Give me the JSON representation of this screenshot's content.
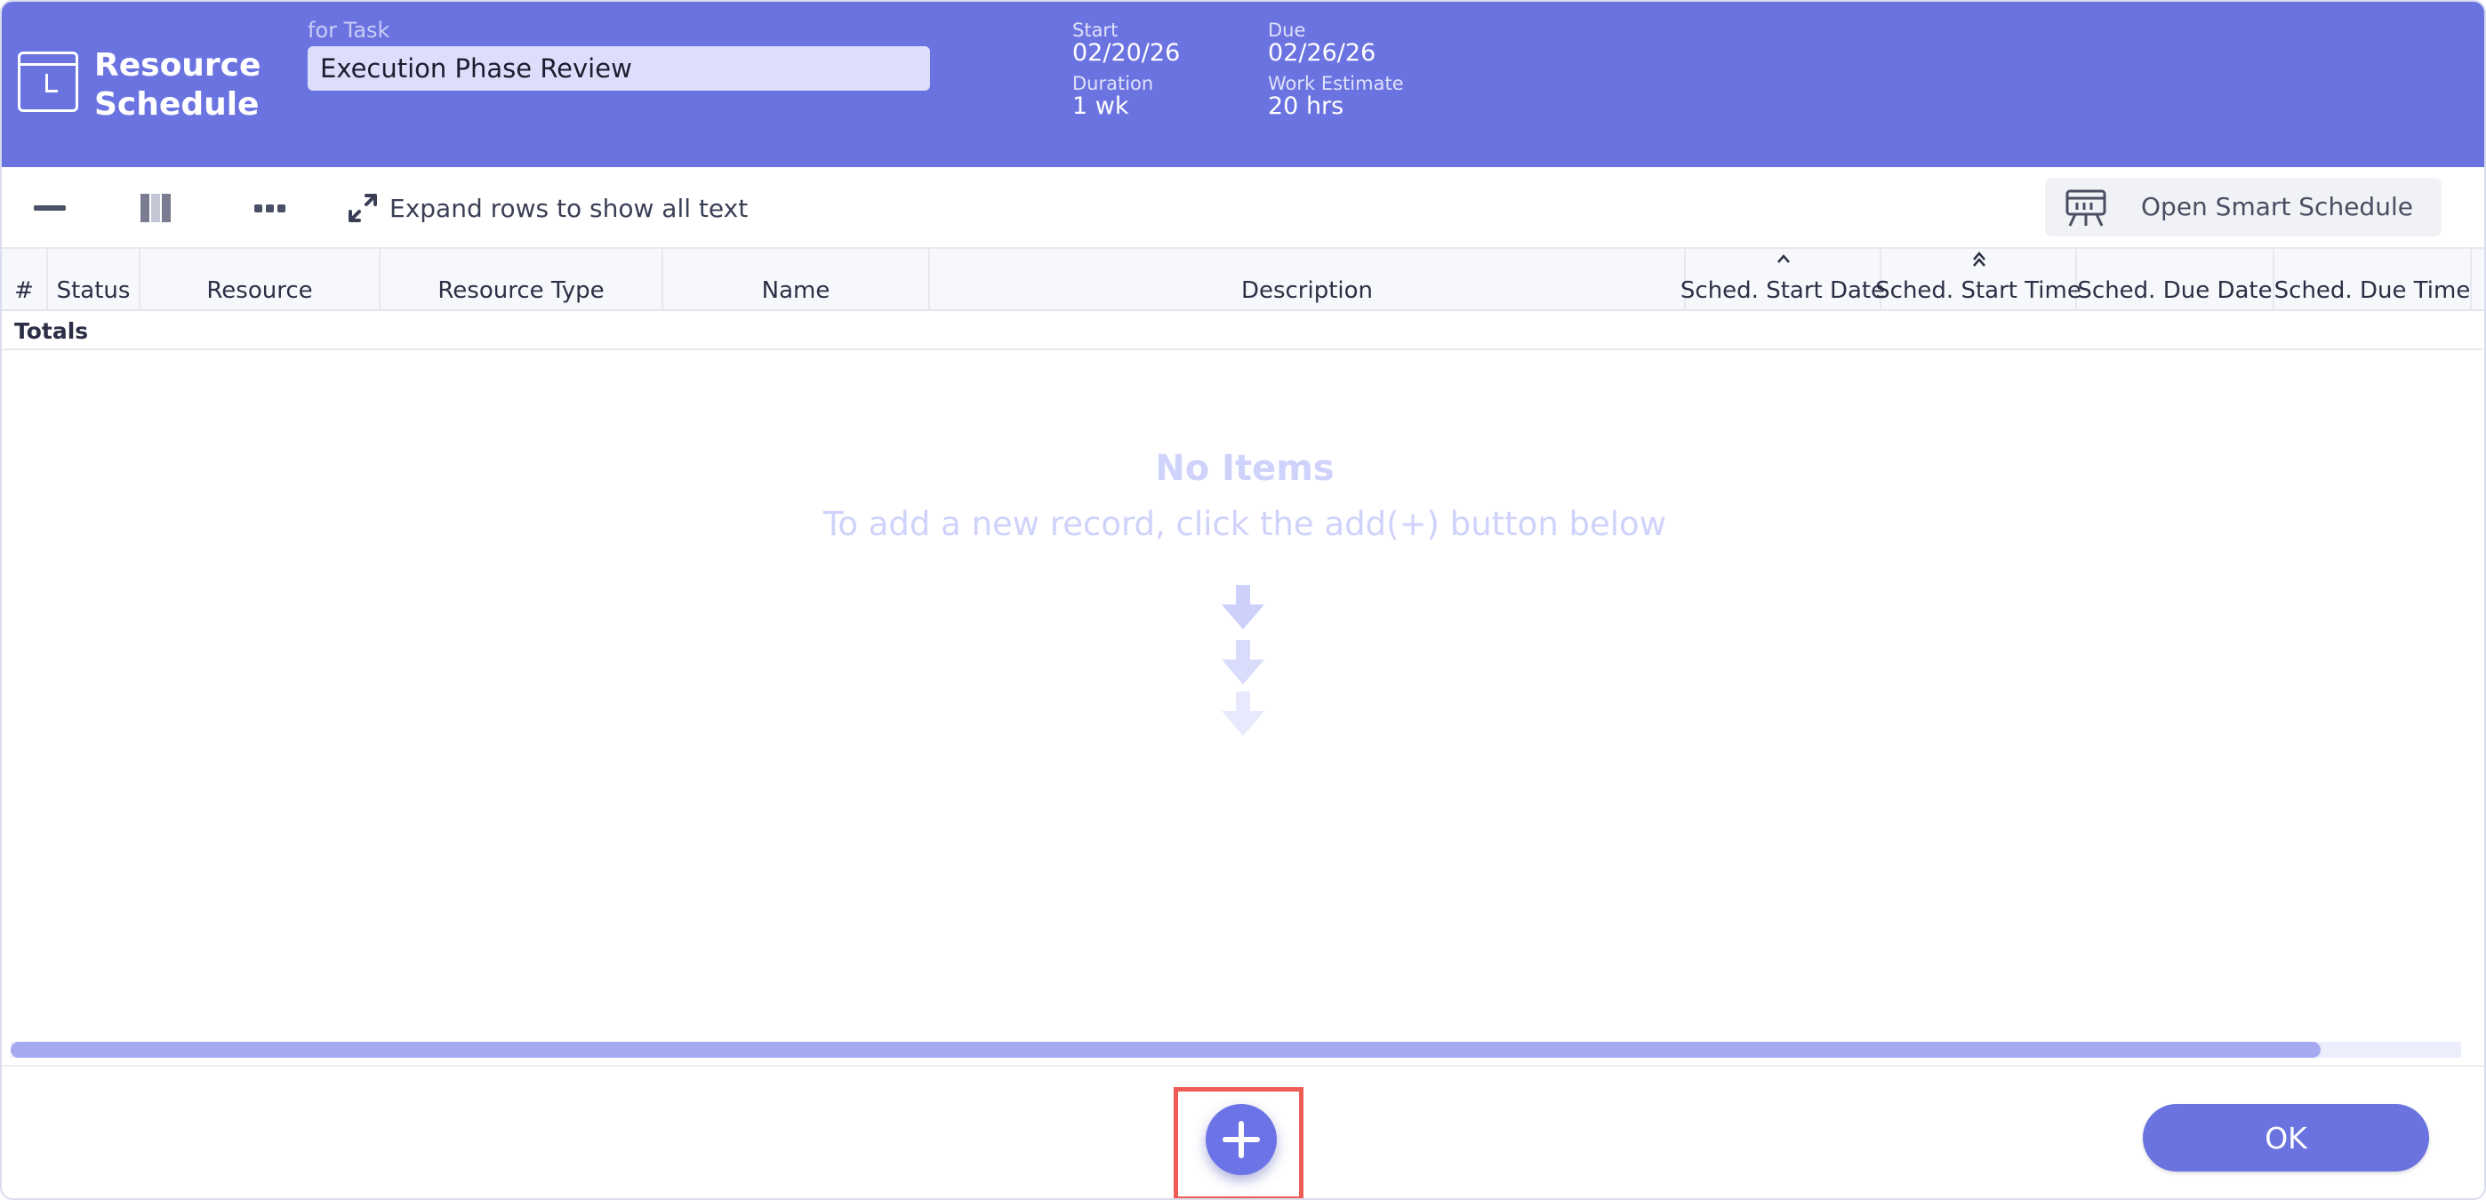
{
  "header": {
    "title": "Resource Schedule",
    "for_task_label": "for Task",
    "task_name": "Execution Phase Review",
    "start_label": "Start",
    "start_value": "02/20/26",
    "due_label": "Due",
    "due_value": "02/26/26",
    "duration_label": "Duration",
    "duration_value": "1 wk",
    "work_estimate_label": "Work Estimate",
    "work_estimate_value": "20 hrs"
  },
  "toolbar": {
    "expand_label": "Expand rows to show all text",
    "smart_schedule_label": "Open Smart Schedule"
  },
  "table": {
    "columns": [
      "#",
      "Status",
      "Resource",
      "Resource Type",
      "Name",
      "Description",
      "Sched. Start Date",
      "Sched. Start Time",
      "Sched. Due Date",
      "Sched. Due Time"
    ],
    "totals_label": "Totals"
  },
  "empty_state": {
    "title": "No Items",
    "subtitle": "To add a new record, click the add(+) button below"
  },
  "footer": {
    "ok_label": "OK"
  },
  "colors": {
    "header_bg": "#6b73e0",
    "accent": "#6c73e6",
    "empty_text": "#cfd2fb",
    "highlight": "#ef5b55"
  },
  "icons": {
    "app": "calendar-clock-icon",
    "collapse": "minus-icon",
    "columns": "columns-icon",
    "more": "more-dots-icon",
    "expand": "expand-arrows-icon",
    "smart_schedule": "gantt-board-icon",
    "add": "plus-icon",
    "empty_arrows": "down-arrow-icon"
  }
}
